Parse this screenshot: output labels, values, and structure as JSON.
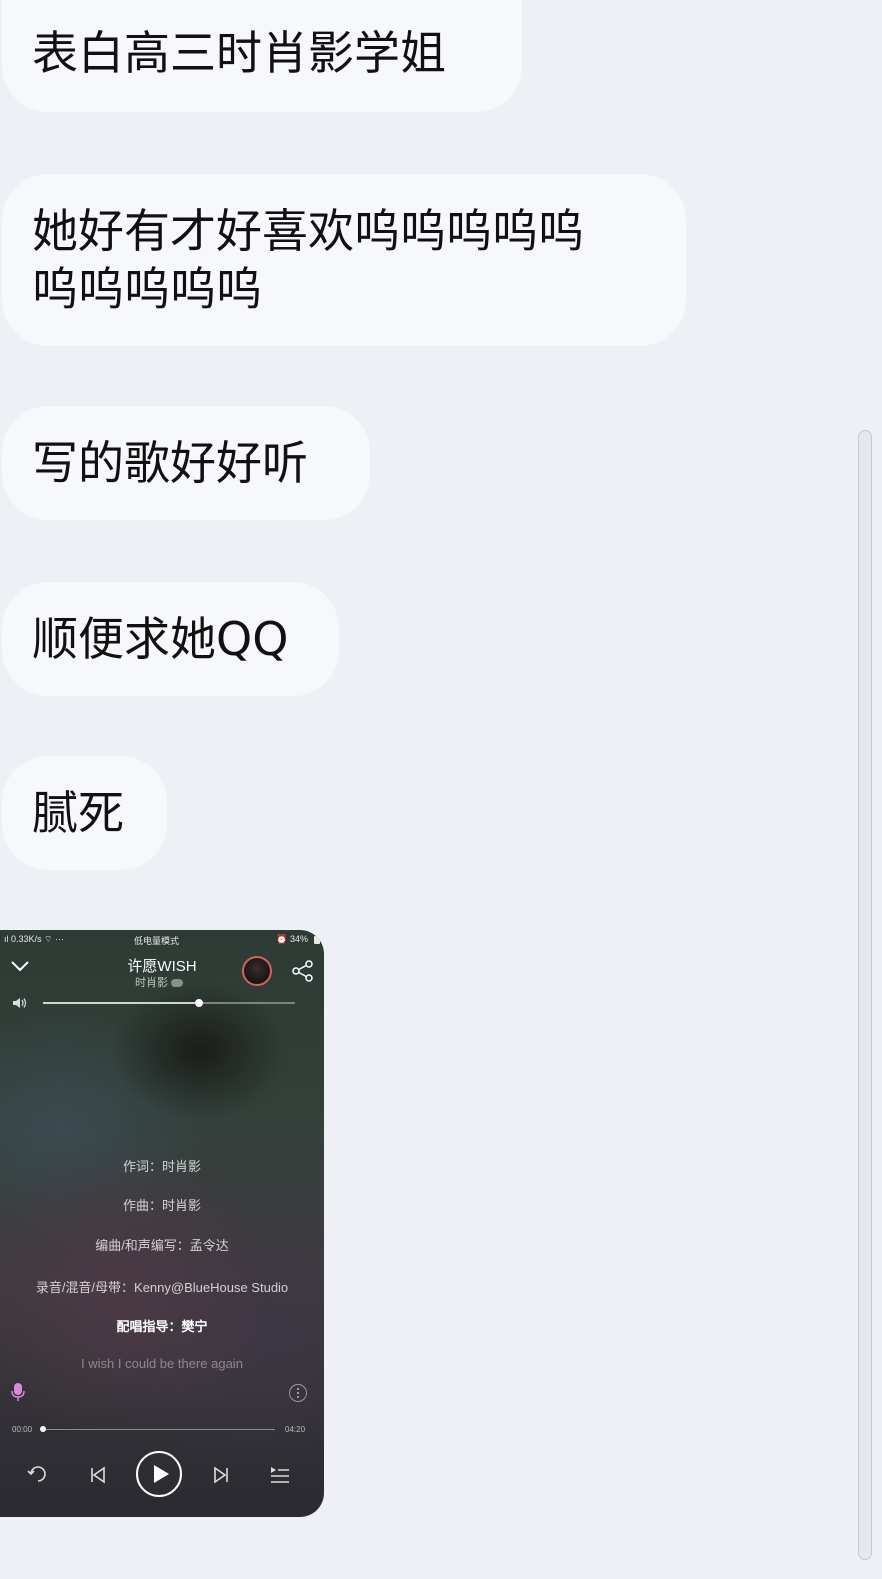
{
  "messages": [
    "表白高三时肖影学姐",
    "她好有才好喜欢呜呜呜呜呜\n呜呜呜呜呜",
    "写的歌好好听",
    "顺便求她QQ",
    "腻死"
  ],
  "player": {
    "status_bar": {
      "network": "0.33K/s",
      "mode": "低电量模式",
      "battery": "34%"
    },
    "song_title": "许愿WISH",
    "artist": "时肖影",
    "volume_level": 0.62,
    "lyrics": [
      "作词：时肖影",
      "作曲：时肖影",
      "编曲/和声编写：孟令达",
      "录音/混音/母带：Kenny@BlueHouse Studio",
      "配唱指导：樊宁",
      "I wish I could be there again"
    ],
    "time_current": "00:00",
    "time_total": "04:20",
    "progress": 0.0
  },
  "colors": {
    "background": "#eef0f5",
    "bubble": "#f7f8fc",
    "avatar_ring": "#d96060",
    "mic_accent": "#d98ad6"
  }
}
